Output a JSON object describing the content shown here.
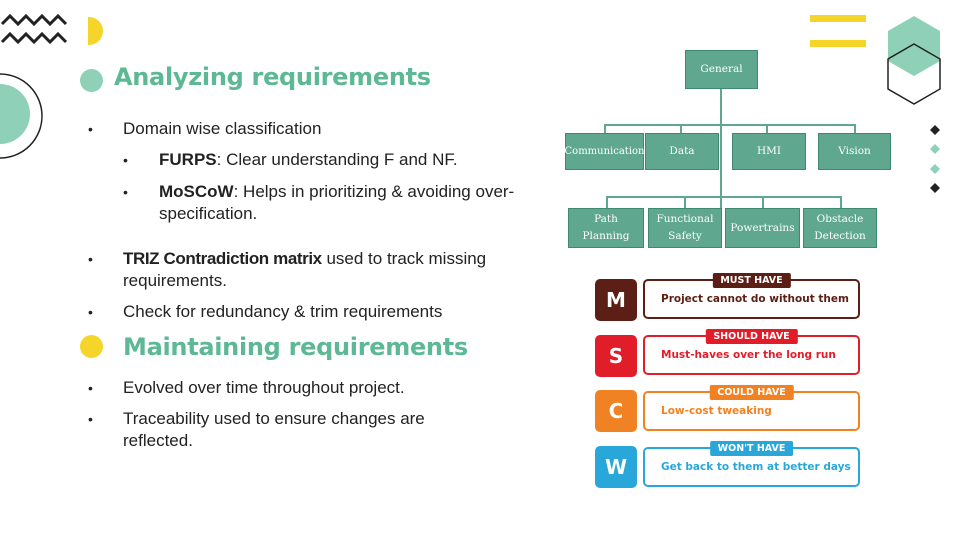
{
  "slide": {
    "heading1": "Analyzing requirements",
    "heading2": "Maintaining requirements",
    "bullets1": {
      "b1": "Domain wise classification",
      "furps_bold": "FURPS",
      "furps_rest": ": Clear understanding F and NF.",
      "moscow_bold": "MoSCoW",
      "moscow_rest": ": Helps in prioritizing & avoiding over-",
      "moscow_cont": "specification.",
      "triz_bold": "TRIZ Contradiction matrix",
      "triz_rest": " used to track missing",
      "triz_cont": "requirements.",
      "b4": "Check for redundancy & trim requirements"
    },
    "bullets2": {
      "b1": "Evolved over time throughout project.",
      "b2": "Traceability used to ensure changes are",
      "b2_cont": "reflected."
    }
  },
  "orgchart": {
    "root": "General",
    "level1": [
      "Communication",
      "Data",
      "HMI",
      "Vision"
    ],
    "level2": [
      "Path Planning",
      "Functional Safety",
      "Powertrains",
      "Obstacle Detection"
    ]
  },
  "moscow": {
    "items": [
      {
        "letter": "M",
        "tag": "MUST HAVE",
        "desc": "Project cannot do without them",
        "color": "#5b1f15"
      },
      {
        "letter": "S",
        "tag": "SHOULD HAVE",
        "desc": "Must-haves over the long run",
        "color": "#e21d2a"
      },
      {
        "letter": "C",
        "tag": "COULD HAVE",
        "desc": "Low-cost tweaking",
        "color": "#f08223"
      },
      {
        "letter": "W",
        "tag": "WON'T HAVE",
        "desc": "Get back to them at better days",
        "color": "#29a7da"
      }
    ]
  },
  "colors": {
    "accent_green": "#5cb895",
    "mint": "#8fd1b8",
    "yellow": "#f6d52b",
    "org_green": "#5fa88f"
  }
}
